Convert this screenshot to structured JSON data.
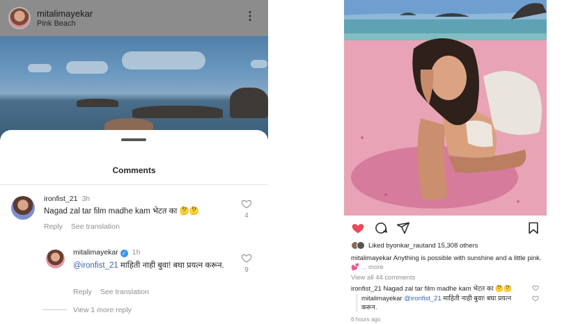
{
  "left": {
    "header": {
      "username": "mitalimayekar",
      "location": "Pink Beach",
      "more_icon": "⋮"
    },
    "sheet": {
      "title": "Comments"
    },
    "comments": [
      {
        "username": "ironfist_21",
        "time": "3h",
        "text": "Nagad zal tar film madhe kam भेटत का 🤔🤔",
        "reply_label": "Reply",
        "translate_label": "See translation",
        "likes": "4"
      }
    ],
    "reply": {
      "username": "mitalimayekar",
      "verified": "✓",
      "time": "1h",
      "mention": "@ironfist_21",
      "text": " माहिती नाही बुवा! बघा प्रयत्न करून.",
      "reply_label": "Reply",
      "translate_label": "See translation",
      "likes": "9"
    },
    "view_more": "View 1 more reply"
  },
  "right": {
    "liked_by_prefix": "Liked by ",
    "liked_by_user": "onkar_raut",
    "liked_by_suffix": " and 15,308 others",
    "caption_user": "mitalimayekar",
    "caption_text": " Anything is possible with sunshine and a little pink.💕",
    "caption_more": "... more",
    "view_all": "View all 44 comments",
    "comment1_user": "ironfist_21",
    "comment1_text": " Nagad zal tar film madhe kam भेटत का 🤔🤔",
    "comment2_user": "mitalimayekar",
    "comment2_mention": " @ironfist_21",
    "comment2_text": " माहिती नाही बुवा! बघा प्रयत्न करून.",
    "time_ago": "6 hours ago",
    "heart_color": "#ed4956"
  }
}
